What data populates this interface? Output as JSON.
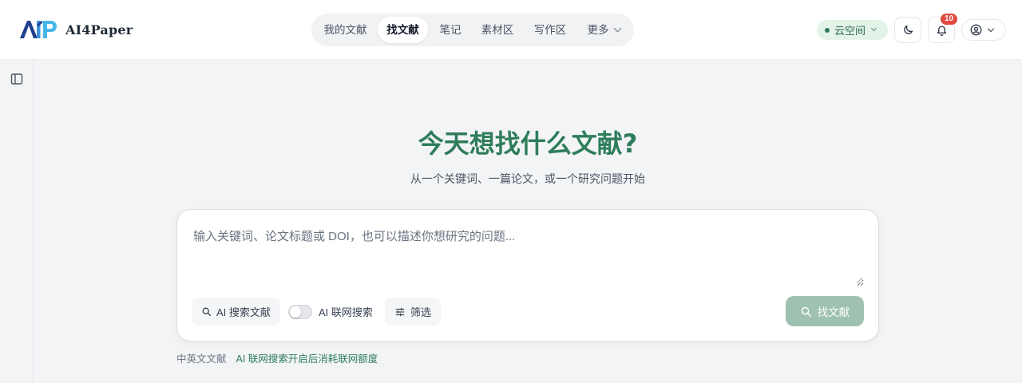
{
  "brand": {
    "logo_text": "AIP",
    "name": "AI4Paper"
  },
  "nav": {
    "items": [
      {
        "label": "我的文献"
      },
      {
        "label": "找文献",
        "active": true
      },
      {
        "label": "笔记"
      },
      {
        "label": "素材区"
      },
      {
        "label": "写作区"
      },
      {
        "label": "更多",
        "has_dropdown": true
      }
    ]
  },
  "header_right": {
    "cloud_label": "云空间",
    "notification_count": "10",
    "theme_icon": "moon-icon",
    "notification_icon": "bell-icon",
    "user_icon": "user-circle-icon"
  },
  "sidebar": {
    "toggle_icon": "sidebar-panel-icon"
  },
  "main": {
    "headline": "今天想找什么文献?",
    "subline": "从一个关键词、一篇论文，或一个研究问题开始",
    "search": {
      "placeholder": "输入关键词、论文标题或 DOI，也可以描述你想研究的问题...",
      "value": ""
    },
    "ai_search_label": "AI 搜索文献",
    "web_search_label": "AI 联网搜索",
    "web_search_enabled": false,
    "filter_label": "筛选",
    "submit_label": "找文献"
  },
  "footnotes": {
    "note1": "中英文文献",
    "note2": "AI 联网搜索开启后消耗联网额度"
  },
  "colors": {
    "accent": "#2e7d5b",
    "submit_disabled": "#9fc1b1",
    "badge": "#e04a3f",
    "cloud_bg": "#e3f3e8",
    "logo_blue": "#1f3f8f",
    "logo_cyan": "#49b6e8"
  }
}
